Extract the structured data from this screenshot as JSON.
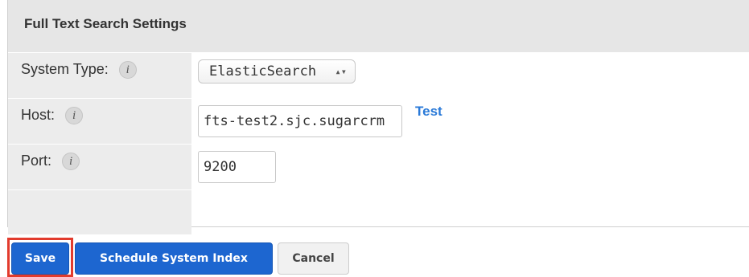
{
  "panel": {
    "title": "Full Text Search Settings",
    "fields": {
      "system_type": {
        "label": "System Type:",
        "info_icon": "info-icon",
        "value": "ElasticSearch",
        "arrows": "▴▾"
      },
      "host": {
        "label": "Host:",
        "info_icon": "info-icon",
        "value": "fts-test2.sjc.sugarcrm",
        "link": "Test"
      },
      "port": {
        "label": "Port:",
        "info_icon": "info-icon",
        "value": "9200"
      }
    },
    "info_glyph": "i"
  },
  "buttons": {
    "save": "Save",
    "schedule": "Schedule System Index",
    "cancel": "Cancel"
  },
  "colors": {
    "primary": "#1d66d0",
    "link": "#2a7ad8",
    "highlight": "#e23b2d"
  }
}
